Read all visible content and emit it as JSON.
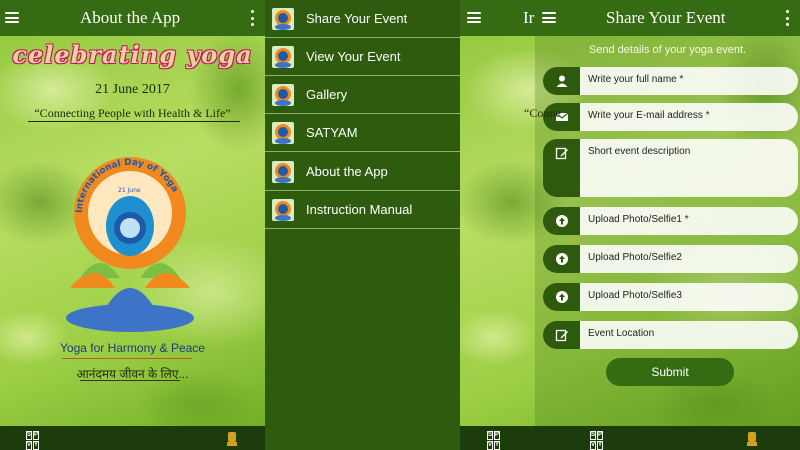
{
  "panel1": {
    "title": "About the App",
    "banner_heading": "celebrating yoga",
    "date": "21 June 2017",
    "tagline": "“Connecting People with Health & Life”",
    "logo_ring_text": "International Day of Yoga",
    "logo_date": "21 June",
    "harmony_text": "Yoga for Harmony & Peace",
    "hindi_text": "आनंदमय जीवन के लिए..."
  },
  "drawer": {
    "items": [
      {
        "label": "Share Your Event"
      },
      {
        "label": "View Your Event"
      },
      {
        "label": "Gallery"
      },
      {
        "label": "SATYAM"
      },
      {
        "label": "About the App"
      },
      {
        "label": "Instruction Manual"
      }
    ]
  },
  "panel3": {
    "title": "Share Your Event",
    "behind_title_fragment": "Ir",
    "behind_tagline_fragment": "“Conne",
    "hint": "Send details of your yoga event.",
    "fields": {
      "name": "Write your full name *",
      "email": "Write your E-mail address *",
      "description": "Short event description",
      "photo1": "Upload Photo/Selfie1 *",
      "photo2": "Upload Photo/Selfie2",
      "photo3": "Upload Photo/Selfie3",
      "location": "Event Location"
    },
    "submit_label": "Submit"
  },
  "bottom_logo_letters": [
    "S",
    "P",
    "V",
    "Y"
  ],
  "colors": {
    "appbar": "#356b12",
    "drawer": "#2f5b0f",
    "bottombar": "#1c3d0b",
    "accent_orange": "#f08a1e",
    "accent_blue": "#1f5aa8"
  }
}
